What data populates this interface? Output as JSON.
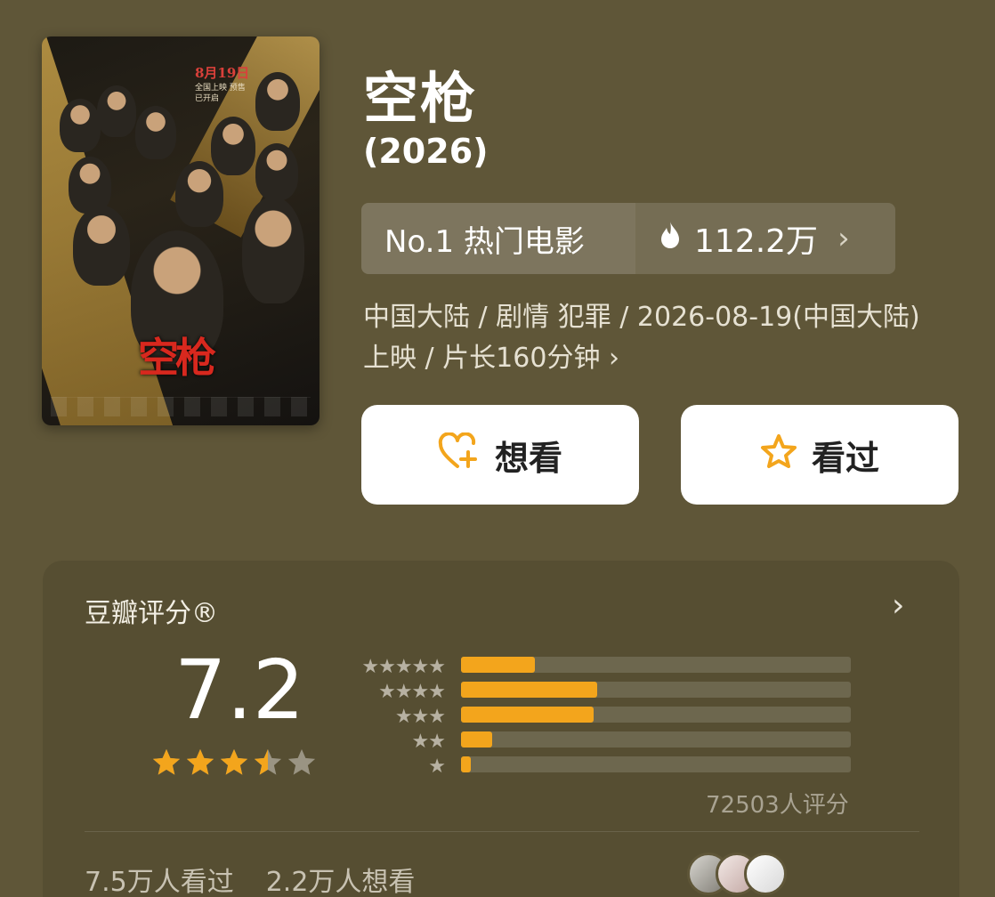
{
  "poster": {
    "date": "8月19日",
    "sub": "全国上映 预售已开启",
    "title": "空枪"
  },
  "movie": {
    "title": "空枪",
    "year": "(2026)"
  },
  "rank": {
    "label": "No.1 热门电影",
    "heat": "112.2万",
    "chevron": "›"
  },
  "meta": {
    "text": "中国大陆 / 剧情 犯罪 / 2026-08-19(中国大陆)上映 / 片长160分钟",
    "chevron": "›"
  },
  "actions": {
    "want_label": "想看",
    "seen_label": "看过"
  },
  "rating": {
    "card_title": "豆瓣评分®",
    "chevron": "›",
    "score": "7.2",
    "star_value": 3.5,
    "star_max": 5,
    "distribution": [
      {
        "stars": "★★★★★",
        "fraction": 0.19
      },
      {
        "stars": "★★★★",
        "fraction": 0.35
      },
      {
        "stars": "★★★",
        "fraction": 0.34
      },
      {
        "stars": "★★",
        "fraction": 0.08
      },
      {
        "stars": "★",
        "fraction": 0.025
      }
    ],
    "count": "72503人评分",
    "seen_count": "7.5万人看过",
    "want_count": "2.2万人想看"
  },
  "colors": {
    "background": "#5f5638",
    "accent": "#f3a51c"
  }
}
